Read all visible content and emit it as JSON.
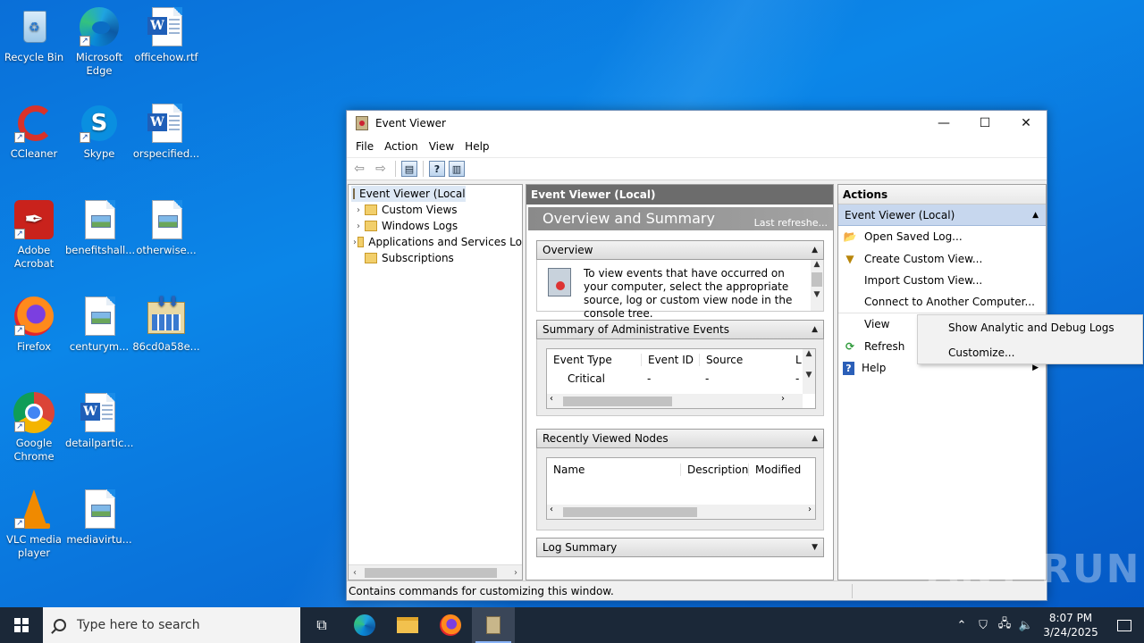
{
  "desktop": {
    "icons": [
      {
        "label": "Recycle Bin"
      },
      {
        "label": "Microsoft Edge"
      },
      {
        "label": "officehow.rtf"
      },
      {
        "label": "CCleaner"
      },
      {
        "label": "Skype"
      },
      {
        "label": "orspecified..."
      },
      {
        "label": "Adobe Acrobat"
      },
      {
        "label": "benefitshall..."
      },
      {
        "label": "otherwise..."
      },
      {
        "label": "Firefox"
      },
      {
        "label": "centurym..."
      },
      {
        "label": "86cd0a58e..."
      },
      {
        "label": "Google Chrome"
      },
      {
        "label": "detailpartic..."
      },
      {
        "label": "VLC media player"
      },
      {
        "label": "mediavirtu..."
      }
    ]
  },
  "window": {
    "title": "Event Viewer",
    "controls": {
      "minimize": "—",
      "maximize": "☐",
      "close": "✕"
    },
    "menu": [
      "File",
      "Action",
      "View",
      "Help"
    ],
    "tree": {
      "root": "Event Viewer (Local)",
      "items": [
        "Custom Views",
        "Windows Logs",
        "Applications and Services Lo",
        "Subscriptions"
      ]
    },
    "middle": {
      "header": "Event Viewer (Local)",
      "banner_title": "Overview and Summary",
      "banner_right": "Last refreshe...",
      "overview": {
        "title": "Overview",
        "text": "To view events that have occurred on your computer, select the appropriate source, log or custom view node in the console tree."
      },
      "admin_summary": {
        "title": "Summary of Administrative Events",
        "columns": [
          "Event Type",
          "Event ID",
          "Source",
          "L"
        ],
        "rows": [
          [
            "Critical",
            "-",
            "-",
            "-"
          ]
        ]
      },
      "recent_nodes": {
        "title": "Recently Viewed Nodes",
        "columns": [
          "Name",
          "Description",
          "Modified"
        ]
      },
      "log_summary": {
        "title": "Log Summary"
      }
    },
    "actions": {
      "header": "Actions",
      "section": "Event Viewer (Local)",
      "items": [
        {
          "label": "Open Saved Log...",
          "icon": "folder-open-icon"
        },
        {
          "label": "Create Custom View...",
          "icon": "filter-icon"
        },
        {
          "label": "Import Custom View..."
        },
        {
          "label": "Connect to Another Computer..."
        },
        {
          "label": "View"
        },
        {
          "label": "Refresh",
          "icon": "refresh-icon"
        },
        {
          "label": "Help",
          "icon": "help-icon"
        }
      ]
    },
    "status": "Contains commands for customizing this window."
  },
  "context_menu": {
    "items": [
      "Show Analytic and Debug Logs",
      "Customize..."
    ]
  },
  "watermark": "ANY RUN",
  "taskbar": {
    "search_placeholder": "Type here to search",
    "time": "8:07 PM",
    "date": "3/24/2025"
  }
}
